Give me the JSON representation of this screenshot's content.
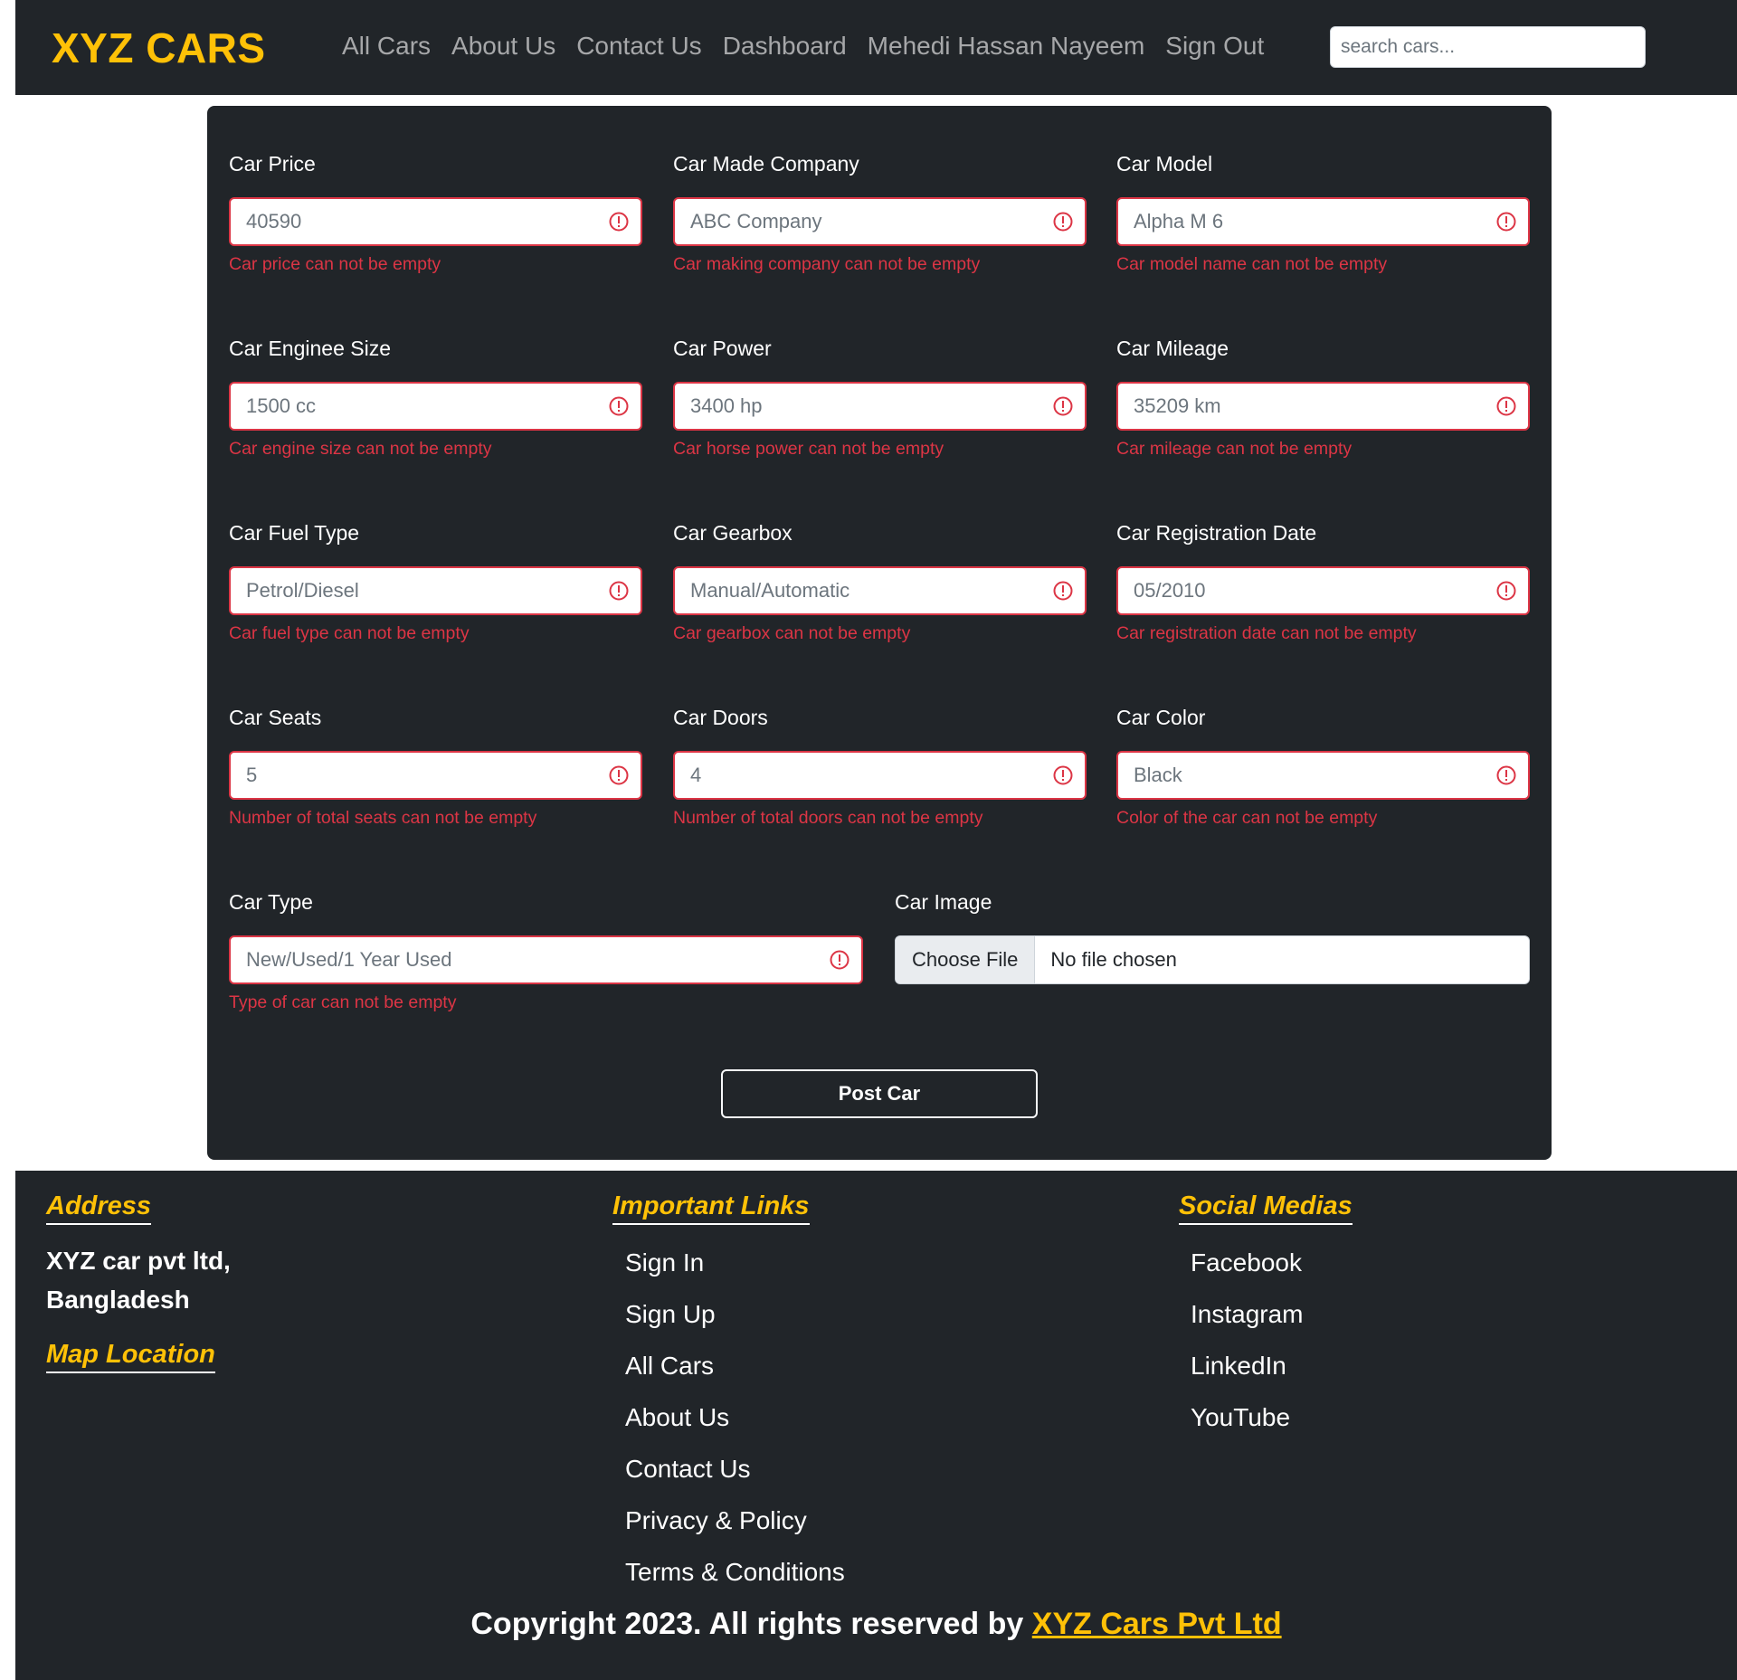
{
  "navbar": {
    "brand": "XYZ CARS",
    "links": [
      "All Cars",
      "About Us",
      "Contact Us",
      "Dashboard",
      "Mehedi Hassan Nayeem",
      "Sign Out"
    ],
    "search_placeholder": "search cars..."
  },
  "form": {
    "fields": [
      {
        "label": "Car Price",
        "placeholder": "40590",
        "error": "Car price can not be empty"
      },
      {
        "label": "Car Made Company",
        "placeholder": "ABC Company",
        "error": "Car making company can not be empty"
      },
      {
        "label": "Car Model",
        "placeholder": "Alpha M 6",
        "error": "Car model name can not be empty"
      },
      {
        "label": "Car Enginee Size",
        "placeholder": "1500 cc",
        "error": "Car engine size can not be empty"
      },
      {
        "label": "Car Power",
        "placeholder": "3400 hp",
        "error": "Car horse power can not be empty"
      },
      {
        "label": "Car Mileage",
        "placeholder": "35209 km",
        "error": "Car mileage can not be empty"
      },
      {
        "label": "Car Fuel Type",
        "placeholder": "Petrol/Diesel",
        "error": "Car fuel type can not be empty"
      },
      {
        "label": "Car Gearbox",
        "placeholder": "Manual/Automatic",
        "error": "Car gearbox can not be empty"
      },
      {
        "label": "Car Registration Date",
        "placeholder": "05/2010",
        "error": "Car registration date can not be empty"
      },
      {
        "label": "Car Seats",
        "placeholder": "5",
        "error": "Number of total seats can not be empty"
      },
      {
        "label": "Car Doors",
        "placeholder": "4",
        "error": "Number of total doors can not be empty"
      },
      {
        "label": "Car Color",
        "placeholder": "Black",
        "error": "Color of the car can not be empty"
      },
      {
        "label": "Car Type",
        "placeholder": "New/Used/1 Year Used",
        "error": "Type of car can not be empty"
      }
    ],
    "image": {
      "label": "Car Image",
      "button": "Choose File",
      "status": "No file chosen"
    },
    "submit": "Post Car",
    "error_icon": "exclamation-circle-icon"
  },
  "footer": {
    "address_heading": "Address",
    "address_line1": "XYZ car pvt ltd,",
    "address_line2": "Bangladesh",
    "map_heading": "Map Location",
    "links_heading": "Important Links",
    "links": [
      "Sign In",
      "Sign Up",
      "All Cars",
      "About Us",
      "Contact Us",
      "Privacy & Policy",
      "Terms & Conditions"
    ],
    "social_heading": "Social Medias",
    "social": [
      "Facebook",
      "Instagram",
      "LinkedIn",
      "YouTube"
    ],
    "copyright_text": "Copyright 2023. All rights reserved by ",
    "copyright_link": "XYZ Cars Pvt Ltd"
  },
  "colors": {
    "accent": "#ffc107",
    "dark": "#212529",
    "error": "#dc3545"
  }
}
